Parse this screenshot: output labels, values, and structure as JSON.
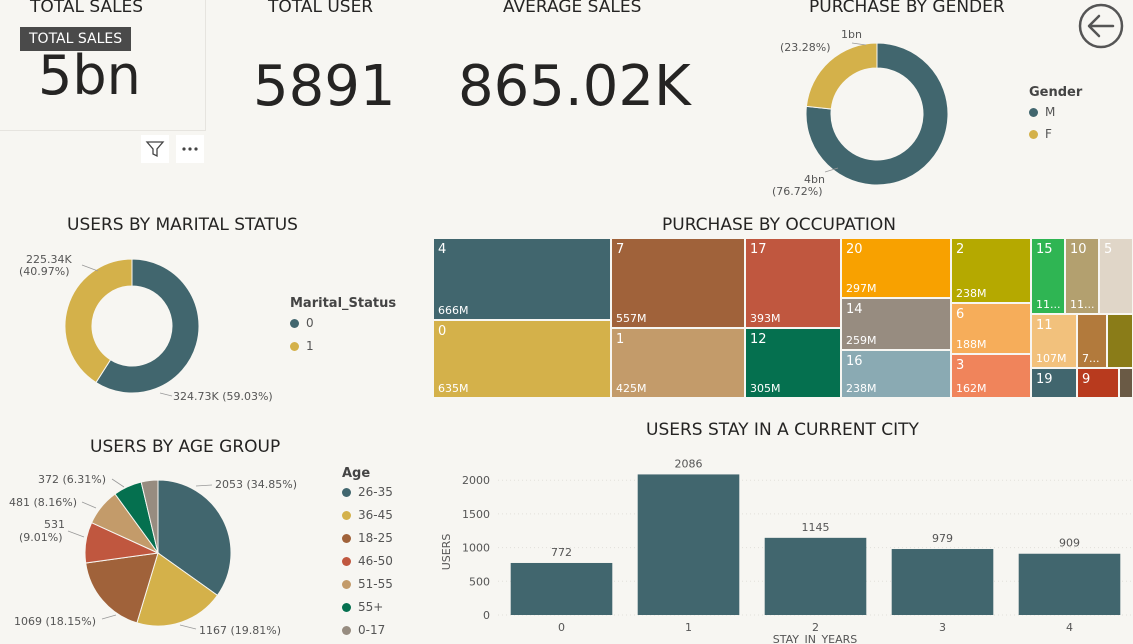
{
  "kpis": {
    "total_sales": {
      "title": "TOTAL SALES",
      "value": "5bn",
      "tooltip": "TOTAL SALES"
    },
    "total_user": {
      "title": "TOTAL USER",
      "value": "5891"
    },
    "average_sales": {
      "title": "AVERAGE SALES",
      "value": "865.02K"
    }
  },
  "colors": {
    "teal": "#41666e",
    "gold": "#d4b14a",
    "brown": "#a0623a",
    "red": "#c0573f",
    "tan": "#c39b6a",
    "green": "#05704f",
    "gray": "#978c80",
    "bg": "#f7f6f2"
  },
  "icons": {
    "filter": "filter-icon",
    "more": "more-options-icon",
    "back": "back-arrow-icon"
  },
  "purchase_by_gender": {
    "title": "PURCHASE BY GENDER",
    "legend_title": "Gender",
    "items": [
      {
        "label": "M",
        "value": 4,
        "display": "4bn",
        "pct": "(76.72%)",
        "color": "#41666e"
      },
      {
        "label": "F",
        "value": 1,
        "display": "1bn",
        "pct": "(23.28%)",
        "color": "#d4b14a"
      }
    ],
    "shares": [
      76.72,
      23.28
    ]
  },
  "users_by_marital_status": {
    "title": "USERS BY MARITAL STATUS",
    "legend_title": "Marital_Status",
    "items": [
      {
        "label": "0",
        "display": "324.73K (59.03%)",
        "share": 59.03,
        "color": "#41666e"
      },
      {
        "label": "1",
        "display": "225.34K",
        "pct": "(40.97%)",
        "share": 40.97,
        "color": "#d4b14a"
      }
    ]
  },
  "users_by_age_group": {
    "title": "USERS BY AGE GROUP",
    "legend_title": "Age",
    "items": [
      {
        "label": "26-35",
        "value": 2053,
        "display": "2053 (34.85%)",
        "color": "#41666e"
      },
      {
        "label": "36-45",
        "value": 1167,
        "display": "1167 (19.81%)",
        "color": "#d4b14a"
      },
      {
        "label": "18-25",
        "value": 1069,
        "display": "1069 (18.15%)",
        "color": "#a0623a"
      },
      {
        "label": "46-50",
        "value": 531,
        "display": "531",
        "pct": "(9.01%)",
        "color": "#c0573f"
      },
      {
        "label": "51-55",
        "value": 481,
        "display": "481 (8.16%)",
        "color": "#c39b6a"
      },
      {
        "label": "55+",
        "value": 372,
        "display": "372 (6.31%)",
        "color": "#05704f"
      },
      {
        "label": "0-17",
        "value": 218,
        "display": "",
        "color": "#978c80"
      }
    ]
  },
  "purchase_by_occupation": {
    "title": "PURCHASE BY OCCUPATION",
    "cells": [
      {
        "id": "4",
        "value": "666M",
        "color": "#41666e"
      },
      {
        "id": "0",
        "value": "635M",
        "color": "#d4b14a"
      },
      {
        "id": "7",
        "value": "557M",
        "color": "#a0623a"
      },
      {
        "id": "1",
        "value": "425M",
        "color": "#c39b6a"
      },
      {
        "id": "17",
        "value": "393M",
        "color": "#c0573f"
      },
      {
        "id": "12",
        "value": "305M",
        "color": "#05704f"
      },
      {
        "id": "20",
        "value": "297M",
        "color": "#f8a100"
      },
      {
        "id": "14",
        "value": "259M",
        "color": "#978c80"
      },
      {
        "id": "16",
        "value": "238M",
        "color": "#8aaab3"
      },
      {
        "id": "2",
        "value": "238M",
        "color": "#b5a900"
      },
      {
        "id": "6",
        "value": "188M",
        "color": "#f6ad5a"
      },
      {
        "id": "3",
        "value": "162M",
        "color": "#f0845b"
      },
      {
        "id": "15",
        "value": "11...",
        "color": "#2fb553"
      },
      {
        "id": "10",
        "value": "11...",
        "color": "#b3a06f"
      },
      {
        "id": "5",
        "value": "",
        "color": "#e0d6c8"
      },
      {
        "id": "11",
        "value": "107M",
        "color": "#f2c17c"
      },
      {
        "id": "",
        "value": "7...",
        "color": "#b27a3c"
      },
      {
        "id": "",
        "value": "",
        "color": "#8a7c18"
      },
      {
        "id": "19",
        "value": "",
        "color": "#41666e"
      },
      {
        "id": "9",
        "value": "",
        "color": "#b83a1e"
      },
      {
        "id": "",
        "value": "",
        "color": "#6a5a45"
      }
    ]
  },
  "users_stay_city": {
    "title": "USERS STAY IN A CURRENT CITY",
    "xlabel": "STAY_IN_YEARS",
    "ylabel": "USERS"
  },
  "chart_data": [
    {
      "type": "pie",
      "title": "PURCHASE BY GENDER",
      "categories": [
        "M",
        "F"
      ],
      "values": [
        76.72,
        23.28
      ],
      "labels": [
        "4bn (76.72%)",
        "1bn (23.28%)"
      ],
      "legend": "right"
    },
    {
      "type": "pie",
      "title": "USERS BY MARITAL STATUS",
      "categories": [
        "0",
        "1"
      ],
      "values": [
        324.73,
        225.34
      ],
      "labels": [
        "324.73K (59.03%)",
        "225.34K (40.97%)"
      ],
      "legend": "right"
    },
    {
      "type": "pie",
      "title": "USERS BY AGE GROUP",
      "categories": [
        "26-35",
        "36-45",
        "18-25",
        "46-50",
        "51-55",
        "55+",
        "0-17"
      ],
      "values": [
        2053,
        1167,
        1069,
        531,
        481,
        372,
        218
      ],
      "legend": "right"
    },
    {
      "type": "bar",
      "title": "USERS STAY IN A CURRENT CITY",
      "categories": [
        "0",
        "1",
        "2",
        "3",
        "4"
      ],
      "values": [
        772,
        2086,
        1145,
        979,
        909
      ],
      "xlabel": "STAY_IN_YEARS",
      "ylabel": "USERS",
      "ylim": [
        0,
        2300
      ],
      "yticks": [
        0,
        500,
        1000,
        1500,
        2000
      ],
      "color": "#41666e",
      "grid": true
    }
  ]
}
